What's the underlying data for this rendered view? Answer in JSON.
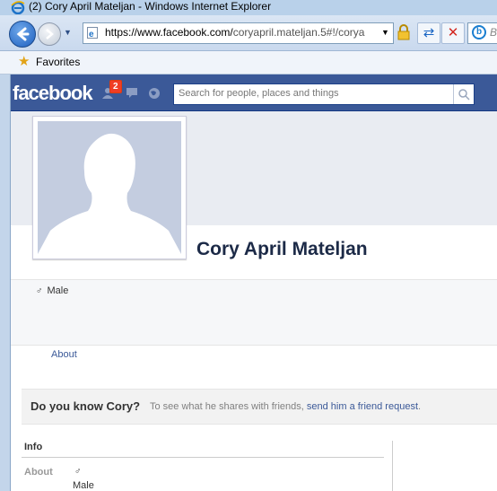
{
  "window": {
    "title": "(2) Cory April Mateljan - Windows Internet Explorer"
  },
  "address": {
    "url_domain": "https://www.facebook.com/",
    "url_rest": "coryapril.mateljan.5#!/corya"
  },
  "search_provider": {
    "text": "B"
  },
  "favorites": {
    "label": "Favorites"
  },
  "facebook": {
    "logo": "facebook",
    "notification_count": "2",
    "search_placeholder": "Search for people, places and things"
  },
  "profile": {
    "name": "Cory April Mateljan",
    "gender_symbol": "♂",
    "gender": "Male",
    "about_link": "About"
  },
  "know_bar": {
    "question": "Do you know Cory?",
    "text_before": "To see what he shares with friends, ",
    "link": "send him a friend request",
    "text_after": "."
  },
  "info": {
    "title": "Info",
    "label": "About",
    "symbol": "♂",
    "value": "Male"
  },
  "colors": {
    "facebook_blue": "#3b5998",
    "name_color": "#1c2a47",
    "badge_red": "#f03d25"
  }
}
